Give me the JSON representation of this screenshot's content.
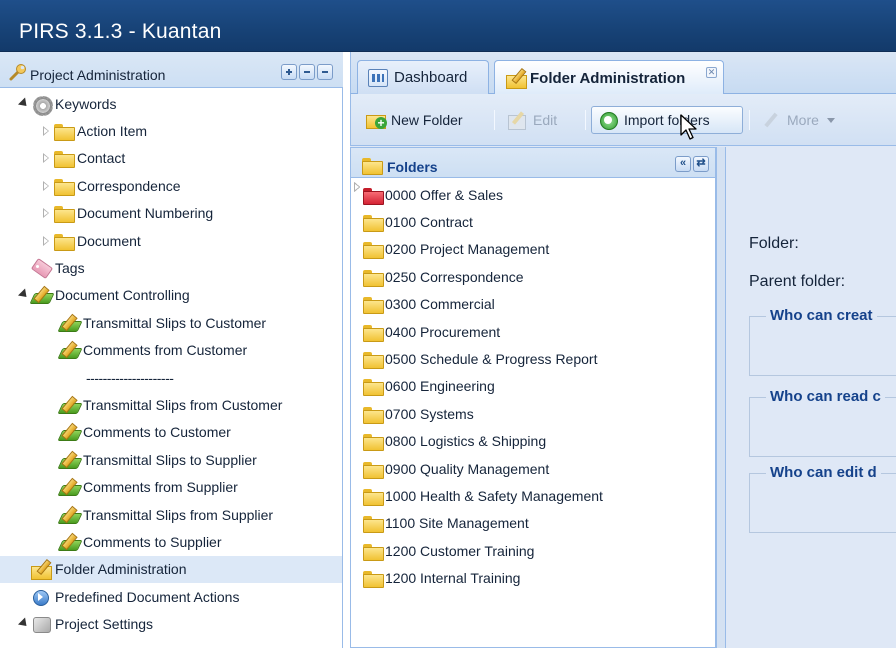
{
  "window": {
    "title": "PIRS 3.1.3  -  Kuantan"
  },
  "left_panel": {
    "title": "Project Administration",
    "items": [
      {
        "label": "Keywords",
        "level": 0,
        "arrow": "open",
        "icon": "gear-icon"
      },
      {
        "label": "Action Item",
        "level": 1,
        "arrow": "closed",
        "icon": "folder-icon"
      },
      {
        "label": "Contact",
        "level": 1,
        "arrow": "closed",
        "icon": "folder-icon"
      },
      {
        "label": "Correspondence",
        "level": 1,
        "arrow": "closed",
        "icon": "folder-icon"
      },
      {
        "label": "Document Numbering",
        "level": 1,
        "arrow": "closed",
        "icon": "folder-icon"
      },
      {
        "label": "Document",
        "level": 1,
        "arrow": "closed",
        "icon": "folder-icon"
      },
      {
        "label": "Tags",
        "level": 0,
        "arrow": "none",
        "icon": "tag-icon"
      },
      {
        "label": "Document Controlling",
        "level": 0,
        "arrow": "open",
        "icon": "pencil-doc-icon"
      },
      {
        "label": "Transmittal Slips to Customer",
        "level": 1,
        "arrow": "none",
        "icon": "pencil-doc-icon"
      },
      {
        "label": "Comments from Customer",
        "level": 1,
        "arrow": "none",
        "icon": "pencil-doc-icon"
      },
      {
        "label": "---------------------",
        "level": 1,
        "arrow": "none",
        "icon": "none"
      },
      {
        "label": "Transmittal Slips from Customer",
        "level": 1,
        "arrow": "none",
        "icon": "pencil-doc-icon"
      },
      {
        "label": "Comments to Customer",
        "level": 1,
        "arrow": "none",
        "icon": "pencil-doc-icon"
      },
      {
        "label": "Transmittal Slips to Supplier",
        "level": 1,
        "arrow": "none",
        "icon": "pencil-doc-icon"
      },
      {
        "label": "Comments from Supplier",
        "level": 1,
        "arrow": "none",
        "icon": "pencil-doc-icon"
      },
      {
        "label": "Transmittal Slips from Supplier",
        "level": 1,
        "arrow": "none",
        "icon": "pencil-doc-icon"
      },
      {
        "label": "Comments to Supplier",
        "level": 1,
        "arrow": "none",
        "icon": "pencil-doc-icon"
      },
      {
        "label": "Folder Administration",
        "level": 0,
        "arrow": "none",
        "icon": "folder-admin-icon",
        "selected": true
      },
      {
        "label": "Predefined Document Actions",
        "level": 0,
        "arrow": "none",
        "icon": "play-circle-icon"
      },
      {
        "label": "Project Settings",
        "level": 0,
        "arrow": "open",
        "icon": "settings-cube-icon"
      }
    ]
  },
  "tabs": [
    {
      "label": "Dashboard",
      "icon": "dashboard-icon",
      "active": false
    },
    {
      "label": "Folder Administration",
      "icon": "folder-admin-icon",
      "active": true,
      "closable": true
    }
  ],
  "toolbar": {
    "new_folder": "New Folder",
    "edit": "Edit",
    "import_folders": "Import folders",
    "more": "More"
  },
  "folders_panel": {
    "title": "Folders",
    "items": [
      {
        "label": "0000 Offer & Sales",
        "color": "red"
      },
      {
        "label": "0100 Contract",
        "color": "yellow"
      },
      {
        "label": "0200 Project Management",
        "color": "yellow"
      },
      {
        "label": "0250 Correspondence",
        "color": "yellow"
      },
      {
        "label": "0300 Commercial",
        "color": "yellow"
      },
      {
        "label": "0400 Procurement",
        "color": "yellow"
      },
      {
        "label": "0500 Schedule & Progress Report",
        "color": "yellow"
      },
      {
        "label": "0600 Engineering",
        "color": "yellow"
      },
      {
        "label": "0700 Systems",
        "color": "yellow"
      },
      {
        "label": "0800 Logistics & Shipping",
        "color": "yellow"
      },
      {
        "label": "0900 Quality Management",
        "color": "yellow"
      },
      {
        "label": "1000 Health & Safety Management",
        "color": "yellow"
      },
      {
        "label": "1100 Site Management",
        "color": "yellow"
      },
      {
        "label": "1200 Customer Training",
        "color": "yellow"
      },
      {
        "label": "1200 Internal Training",
        "color": "yellow"
      }
    ]
  },
  "details": {
    "folder_label": "Folder:",
    "parent_label": "Parent folder:",
    "sections": [
      {
        "legend": "Who can creat"
      },
      {
        "legend": "Who can read c"
      },
      {
        "legend": "Who can edit d"
      }
    ]
  },
  "colors": {
    "titlebar": "#174276",
    "panel_header": "#cddff3",
    "accent_text": "#15428b",
    "border": "#99bbe8"
  }
}
